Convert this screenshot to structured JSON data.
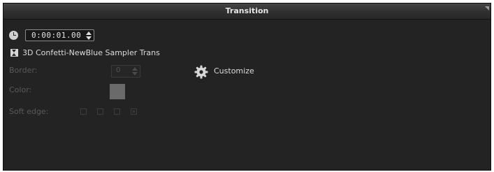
{
  "panel": {
    "title": "Transition"
  },
  "duration": {
    "value": "0:00:01.00"
  },
  "transition": {
    "name": "3D Confetti-NewBlue Sampler Trans"
  },
  "border": {
    "label": "Border:",
    "value": "0"
  },
  "color": {
    "label": "Color:",
    "swatch": "#6a6a6a"
  },
  "soft_edge": {
    "label": "Soft edge:",
    "options": [
      "none",
      "weak",
      "medium",
      "strong"
    ]
  },
  "customize": {
    "label": "Customize"
  },
  "icons": {
    "clock": "clock-icon",
    "transition": "transition-icon",
    "gear": "gear-icon"
  }
}
